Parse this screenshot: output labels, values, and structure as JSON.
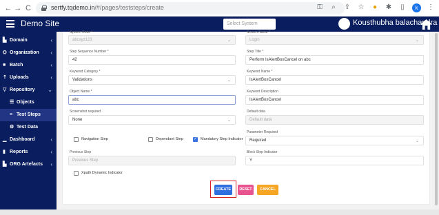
{
  "browser": {
    "url_host": "sertfy.tqdemo.in",
    "url_path": "/#/pages/teststeps/create",
    "back_icon": "arrow-left",
    "forward_icon": "arrow-right",
    "reload_icon": "reload",
    "profile_initial": "k"
  },
  "topbar": {
    "site_title": "Demo Site",
    "select_system_placeholder": "Select System",
    "username": "Kousthubha balachandra"
  },
  "sidebar": {
    "items": [
      {
        "label": "Domain",
        "icon": "chart-icon",
        "chevron": "‹"
      },
      {
        "label": "Organization",
        "icon": "organization-icon",
        "chevron": "‹"
      },
      {
        "label": "Batch",
        "icon": "folder-icon",
        "chevron": "‹"
      },
      {
        "label": "Uploads",
        "icon": "upload-icon",
        "chevron": "‹"
      },
      {
        "label": "Repository",
        "icon": "filter-icon",
        "chevron": "⌄"
      },
      {
        "label": "Objects",
        "icon": "stack-icon",
        "chevron": ""
      },
      {
        "label": "Test Steps",
        "icon": "list-icon",
        "chevron": ""
      },
      {
        "label": "Test Data",
        "icon": "tree-icon",
        "chevron": ""
      },
      {
        "label": "Dashboard",
        "icon": "bar-chart-icon",
        "chevron": "‹"
      },
      {
        "label": "Reports",
        "icon": "file-icon",
        "chevron": "‹"
      },
      {
        "label": "ORG Artefacts",
        "icon": "chart-icon",
        "chevron": "‹"
      }
    ]
  },
  "form": {
    "system_code_label": "System Code *",
    "system_code_value": "abcxyz123",
    "screen_name_label": "Screen Name *",
    "screen_name_value": "Login",
    "step_sequence_label": "Step Sequence Number *",
    "step_sequence_value": "42",
    "step_title_label": "Step Title *",
    "step_title_value": "Perform IsAlertBoxCancel on abc",
    "keyword_category_label": "Keyword Category *",
    "keyword_category_value": "Validations",
    "keyword_name_label": "Keyword Name *",
    "keyword_name_value": "IsAlertBoxCancel",
    "object_name_label": "Object Name *",
    "object_name_value": "abc",
    "keyword_description_label": "Keyword Description",
    "keyword_description_value": "IsAlertBoxCancel",
    "screenshot_label": "Screenshot required",
    "screenshot_value": "None",
    "default_data_label": "Default data",
    "default_data_placeholder": "Default data",
    "navigation_step_label": "Navigation Step",
    "dependant_step_label": "Dependant Step",
    "mandatory_step_label": "Mandatory Step Indicator",
    "parameter_required_label": "Parameter Required",
    "parameter_required_value": "Required",
    "previous_step_label": "Previous Step",
    "previous_step_placeholder": "Previous Step",
    "block_step_label": "Block Step Indicator",
    "block_step_value": "Y",
    "xpath_dynamic_label": "Xpath Dynamic Indicator"
  },
  "actions": {
    "create_label": "CREATE",
    "reset_label": "RESET",
    "cancel_label": "CANCEL"
  },
  "colors": {
    "sidebar_bg": "#0a1d5e",
    "create": "#2f6fe0",
    "reset": "#e8548f",
    "cancel": "#f5a623",
    "highlight": "#d62020"
  }
}
